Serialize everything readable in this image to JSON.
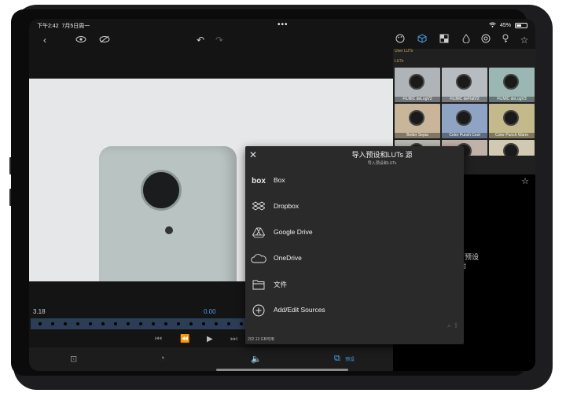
{
  "status": {
    "time": "下午2:42",
    "date": "7月5日周一",
    "dots": "•••",
    "battery": "45%"
  },
  "toolbar": {
    "icons": [
      "chevron-left-icon",
      "eye-icon",
      "eye-slash-icon",
      "undo-icon",
      "redo-icon",
      "palette-icon",
      "lut-cube-icon",
      "grid-icon",
      "drop-icon",
      "target-icon",
      "key-icon",
      "star-icon"
    ]
  },
  "lut_panel": {
    "heading_user": "User LUTs",
    "heading_luts": "LUTs",
    "tiles": [
      {
        "label": "FiLMiC deLogV2",
        "color": "#aeb4b8"
      },
      {
        "label": "FiLMiC deFlatV2",
        "color": "#b6bcc0"
      },
      {
        "label": "FiLMiC deLogV3",
        "color": "#9bb7b4"
      },
      {
        "label": "Better Sepia",
        "color": "#c8b59a"
      },
      {
        "label": "Color Punch Cool",
        "color": "#8fa3c4"
      },
      {
        "label": "Color Punch Warm",
        "color": "#c3b98a"
      },
      {
        "label": "",
        "color": "#b9bab0"
      },
      {
        "label": "",
        "color": "#c0b2a7"
      },
      {
        "label": "",
        "color": "#d2c9b1"
      }
    ]
  },
  "lut_side": {
    "note_line1": "可预设",
    "note_line2": "始"
  },
  "timeline": {
    "timecode_left": "3.18",
    "timecode_mid": "0.00"
  },
  "bottombar": {
    "label_active": "预设"
  },
  "sheet": {
    "title": "导入预设和LUTs 源",
    "subtitle": "导入预设和LUTs",
    "sources": [
      {
        "label": "Box",
        "icon": "box-icon"
      },
      {
        "label": "Dropbox",
        "icon": "dropbox-icon"
      },
      {
        "label": "Google Drive",
        "icon": "google-drive-icon"
      },
      {
        "label": "OneDrive",
        "icon": "onedrive-icon"
      },
      {
        "label": "文件",
        "icon": "files-icon"
      },
      {
        "label": "Add/Edit Sources",
        "icon": "add-circle-icon"
      }
    ],
    "storage": "202.13 GB可用"
  }
}
